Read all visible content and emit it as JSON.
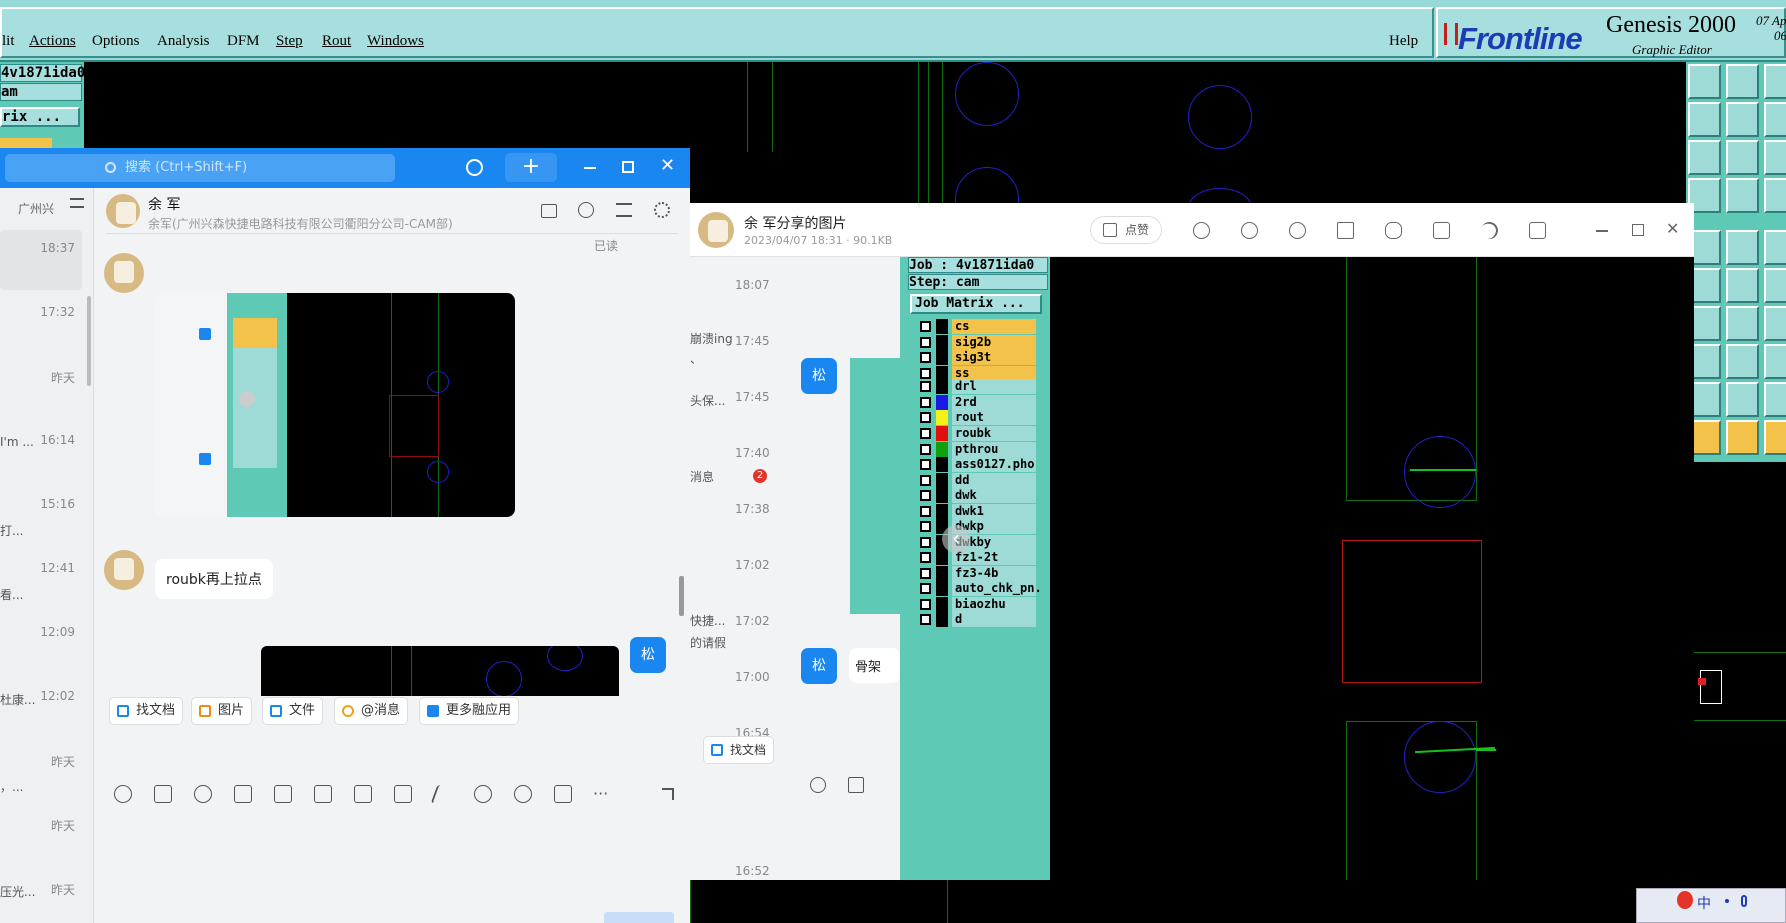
{
  "genesis": {
    "menu": [
      "lit",
      "Actions",
      "Options",
      "Analysis",
      "DFM",
      "Step",
      "Rout",
      "Windows"
    ],
    "help": "Help",
    "logo": "Frontline",
    "product": "Genesis 2000",
    "product_sub": "Graphic Editor",
    "date_line1": "07 Ap",
    "date_line2": "06:",
    "left_panel": {
      "job": "4v1871ida0",
      "step": "am",
      "matrix": "rix ..."
    }
  },
  "chat": {
    "search_placeholder": "搜索 (Ctrl+Shift+F)",
    "plus": "+",
    "conv_header": "广州兴",
    "conv_times": [
      "18:37",
      "17:32",
      "昨天",
      "16:14",
      "15:16",
      "12:41",
      "12:09",
      "12:02",
      "昨天",
      "昨天",
      "昨天"
    ],
    "conv_snippets": [
      "I'm ...",
      "打...",
      "看...",
      "杜康...",
      "，...",
      "压光..."
    ],
    "contact_name": "余  军",
    "contact_sub": "余军(广州兴森快捷电路科技有限公司衢阳分公司-CAM部)",
    "read_status": "已读",
    "message_text": "roubk再上拉点",
    "my_avatar": "松",
    "quick_buttons": [
      "找文档",
      "图片",
      "文件",
      "@消息",
      "更多融应用"
    ]
  },
  "viewer": {
    "title": "余  军分享的图片",
    "meta": "2023/04/07 18:31 · 90.1KB",
    "like": "点赞",
    "bg_times": [
      "18:07",
      "17:45",
      "17:45",
      "17:40",
      "17:38",
      "17:02",
      "17:02",
      "17:00",
      "16:54",
      "16:52"
    ],
    "bg_snippets": [
      "崩溃ing",
      "、",
      "头保...",
      "消息",
      "快捷...",
      "的请假"
    ],
    "bg_badge": "2",
    "bg_avatar": "松",
    "bg_bubble": "骨架",
    "bg_find": "找文档",
    "job": "Job : 4v1871ida0",
    "step": "Step: cam",
    "job_matrix": "Job Matrix ...",
    "layers_a": [
      "cs",
      "sig2b",
      "sig3t",
      "ss"
    ],
    "layers_b": [
      "drl",
      "2rd",
      "rout"
    ],
    "layers_c": [
      "roubk",
      "pthrou",
      "ass0127.pho",
      "dd",
      "dwk",
      "dwk1",
      "dwkp",
      "dwkby",
      "fz1-2t",
      "fz3-4b",
      "auto_chk_pn.",
      "biaozhu",
      "d"
    ]
  },
  "taskbar": {
    "ime": "中"
  }
}
